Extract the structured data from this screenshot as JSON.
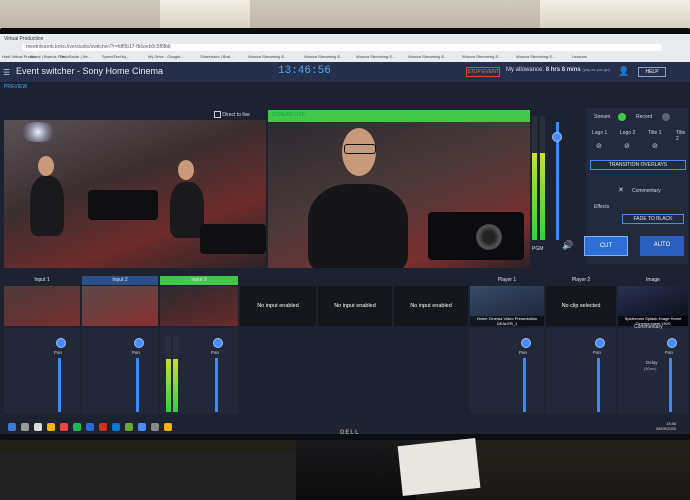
{
  "browser": {
    "tab_title": "Virtual Production",
    "url": "meetnlearnb.knko.live/studio/switcher/?r=fdf0b17-fb5eeb0c5f6fbb",
    "bookmarks": [
      "Host Virtual Produc...",
      "Home | Brands Pub...",
      "TechRadar | Ne...",
      "SpeedTest by...",
      "My Drive - Google...",
      "Sharetrace | Brai...",
      "Wowza Streaming E...",
      "Wowza Streaming E...",
      "Wowza Streaming E...",
      "Wowza Streaming E...",
      "Wowza Streaming E...",
      "Wowza Streaming E...",
      "Lessons"
    ]
  },
  "app": {
    "title": "Event switcher - Sony Home Cinema",
    "clock": "13:46:56",
    "stop_event": "STOP EVENT",
    "allowance_label": "My allowance:",
    "allowance_value": "8 hrs 8 mins",
    "allowance_note": "(pay as you go)",
    "help": "HELP"
  },
  "preview": {
    "label": "PREVIEW",
    "direct_to_live": "Direct to live"
  },
  "program": {
    "label": "STREAM LIVE",
    "pgm": "PGM"
  },
  "controls": {
    "stream": "Stream",
    "record": "Record",
    "logos": [
      "Logo 1",
      "Logo 2",
      "Title 1",
      "Title 2"
    ],
    "transition_overlays": "TRANSITION OVERLAYS",
    "commentary": "Commentary",
    "effects": "Effects",
    "fade_to_black": "FADE TO BLACK",
    "cut": "CUT",
    "auto": "AUTO"
  },
  "inputs": [
    {
      "label": "Input 1",
      "num": "1"
    },
    {
      "label": "Input 2",
      "num": "2"
    },
    {
      "label": "Input 3",
      "num": "3"
    },
    {
      "label": "",
      "text": "No input enabled"
    },
    {
      "label": "",
      "text": "No input enabled"
    },
    {
      "label": "",
      "text": "No input enabled"
    },
    {
      "label": "Player 1",
      "caption": "Home Cinema Video Presentation DEALER_1"
    },
    {
      "label": "Player 2",
      "text": "No clip selected"
    },
    {
      "label": "Image",
      "caption": "Spiderman Splash Image Home Cinema event 1920"
    }
  ],
  "audio": {
    "pan": "Pan",
    "commentary": "Commentary",
    "delay": "Delay",
    "delay_value": "(50ms)"
  },
  "taskbar": {
    "time": "13:46",
    "date": "08/09/2020"
  },
  "monitor_brand": "DELL",
  "colors": {
    "accent": "#3a8aff",
    "live_green": "#3fc84a",
    "stop_red": "#e0453a",
    "header": "#27304a"
  }
}
